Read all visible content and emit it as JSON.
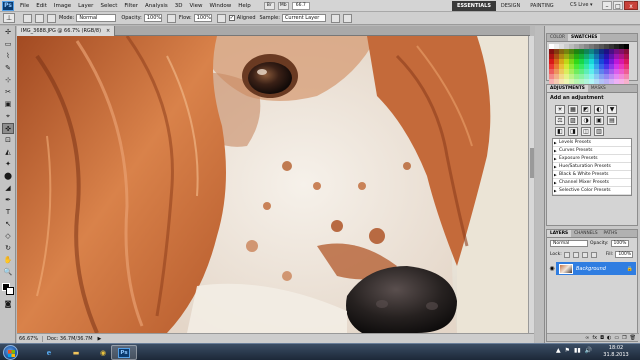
{
  "app": {
    "logo": "Ps"
  },
  "menu": [
    "File",
    "Edit",
    "Image",
    "Layer",
    "Select",
    "Filter",
    "Analysis",
    "3D",
    "View",
    "Window",
    "Help"
  ],
  "menubar_mini": [
    "Br",
    "Mb"
  ],
  "menubar_zoom": "66.7",
  "workspaces": [
    "ESSENTIALS",
    "DESIGN",
    "PAINTING"
  ],
  "cslive": "CS Live ▾",
  "window_controls": {
    "minimize": "–",
    "maximize": "□",
    "close": "x"
  },
  "options": {
    "mode_label": "Mode:",
    "mode_value": "Normal",
    "opacity_label": "Opacity:",
    "opacity_value": "100%",
    "flow_label": "Flow:",
    "flow_value": "100%",
    "aligned_label": "Aligned",
    "sample_label": "Sample:",
    "sample_value": "Current Layer"
  },
  "document": {
    "tab": "IMG_3688.JPG @ 66.7% (RGB/8)",
    "close": "×"
  },
  "status": {
    "zoom": "66.67%",
    "doc": "Doc: 36.7M/36.7M",
    "arrow": "▶"
  },
  "panels": {
    "color_tabs": [
      "COLOR",
      "SWATCHES"
    ],
    "adjust_tabs": [
      "ADJUSTMENTS",
      "MASKS"
    ],
    "adjust_title": "Add an adjustment",
    "adjust_icons": [
      "☀",
      "▦",
      "◩",
      "◐",
      "▼",
      "⚖",
      "▨",
      "◑",
      "▣",
      "▤",
      "◧",
      "◨",
      "◫",
      "▥"
    ],
    "presets": [
      "Levels Presets",
      "Curves Presets",
      "Exposure Presets",
      "Hue/Saturation Presets",
      "Black & White Presets",
      "Channel Mixer Presets",
      "Selective Color Presets"
    ],
    "layer_tabs": [
      "LAYERS",
      "CHANNELS",
      "PATHS"
    ],
    "blend_mode": "Normal",
    "opacity_label": "Opacity:",
    "opacity_value": "100%",
    "lock_label": "Lock:",
    "fill_label": "Fill:",
    "fill_value": "100%",
    "layer_name": "Background",
    "layer_lock": "🔒"
  },
  "tools": [
    "▭",
    "✢",
    "⌇",
    "✎",
    "⊹",
    "✂",
    "▣",
    "⌖",
    "✜",
    "⊡",
    "◭",
    "✦",
    "⬤",
    "◢",
    "T",
    "↖",
    "◇",
    "✋",
    "🔍"
  ],
  "taskbar": {
    "ie": "e",
    "folder": "▬",
    "chrome": "◉",
    "ps": "Ps",
    "tray": [
      "▲",
      "⚑",
      "▮▮",
      "🔊"
    ],
    "time": "18:02",
    "date": "31.8.2013"
  },
  "colors": {
    "accent_selected_layer": "#2f7de1",
    "workspace_active": "#3a3a3a"
  }
}
